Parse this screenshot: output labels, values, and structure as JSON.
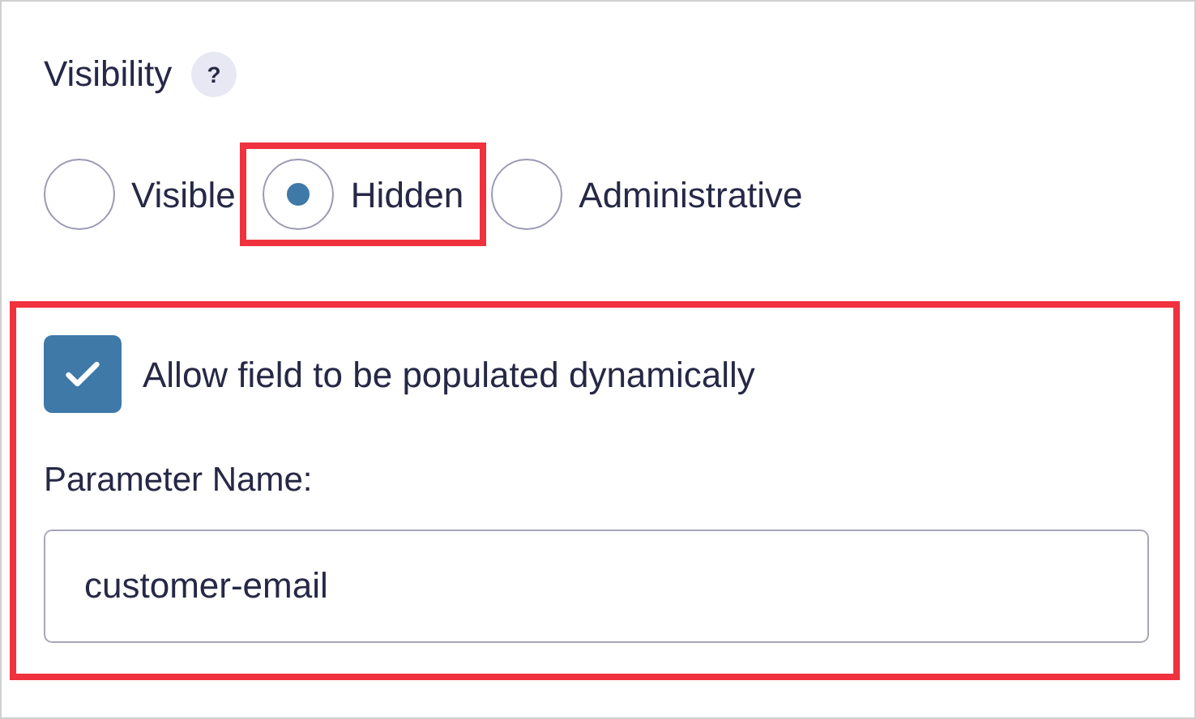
{
  "visibility": {
    "label": "Visibility",
    "help": "?",
    "options": [
      {
        "label": "Visible",
        "selected": false,
        "highlighted": false
      },
      {
        "label": "Hidden",
        "selected": true,
        "highlighted": true
      },
      {
        "label": "Administrative",
        "selected": false,
        "highlighted": false
      }
    ]
  },
  "dynamic": {
    "highlighted": true,
    "checkbox": {
      "label": "Allow field to be populated dynamically",
      "checked": true
    },
    "parameter": {
      "label": "Parameter Name:",
      "value": "customer-email"
    }
  }
}
